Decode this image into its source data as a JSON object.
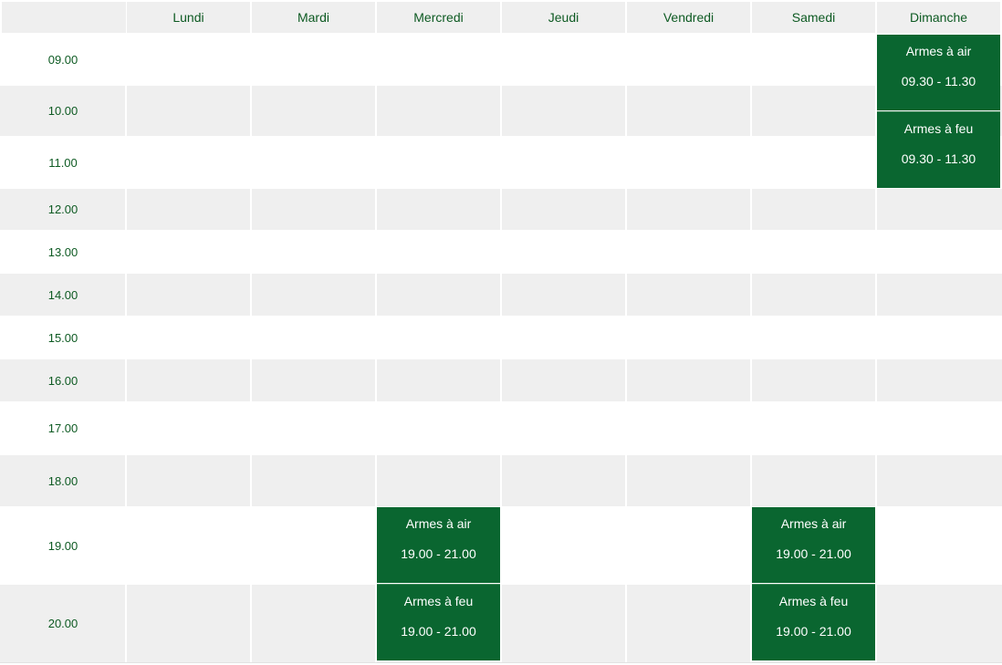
{
  "days": [
    "Lundi",
    "Mardi",
    "Mercredi",
    "Jeudi",
    "Vendredi",
    "Samedi",
    "Dimanche"
  ],
  "times": [
    "09.00",
    "10.00",
    "11.00",
    "12.00",
    "13.00",
    "14.00",
    "15.00",
    "16.00",
    "17.00",
    "18.00",
    "19.00",
    "20.00"
  ],
  "events": [
    {
      "day": "Dimanche",
      "title": "Armes à air",
      "time": "09.30 - 11.30"
    },
    {
      "day": "Dimanche",
      "title": "Armes à feu",
      "time": "09.30 - 11.30"
    },
    {
      "day": "Mercredi",
      "title": "Armes à air",
      "time": "19.00 - 21.00"
    },
    {
      "day": "Mercredi",
      "title": "Armes à feu",
      "time": "19.00 - 21.00"
    },
    {
      "day": "Samedi",
      "title": "Armes à air",
      "time": "19.00 - 21.00"
    },
    {
      "day": "Samedi",
      "title": "Armes à feu",
      "time": "19.00 - 21.00"
    }
  ],
  "colors": {
    "accent": "#0a6630",
    "label": "#0d5a22",
    "stripe": "#efefef"
  }
}
